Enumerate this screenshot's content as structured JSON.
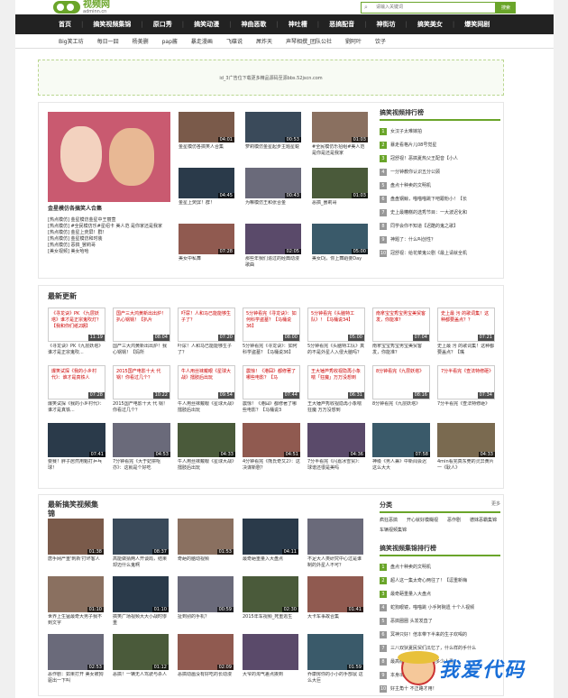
{
  "header": {
    "logo_text": "视频网",
    "logo_sub": "adminn.cn",
    "search_placeholder": "请输入关键词",
    "search_button": "搜索"
  },
  "nav": [
    "首页",
    "搞笑视频集锦",
    "原口秀",
    "搞笑动漫",
    "神曲恶歌",
    "神吐槽",
    "恶搞配音",
    "神街坊",
    "搞笑美女",
    "爆笑网剧"
  ],
  "subnav": [
    "Big笑工坊",
    "每日一囧",
    "杨美删",
    "pap酱",
    "暴走漫画",
    "飞碟说",
    "屌炸天",
    "声琴相撰_团队公社",
    "劉阿叶",
    "饮子"
  ],
  "ad": {
    "text": "id_3广告位下载更多精品源码至源bbs.52jscn.com"
  },
  "top_section": {
    "featured": {
      "caption": "金星模仿各搞笑人合集",
      "links": [
        "[热点模仿] 金星模仿金星中王丽萱",
        "[热点模仿] #全民模仿乐#星绍卡 美人范 是你家还是我家",
        "[热点模仿] 金星上荧屏！群！",
        "[热点模仿] 金星模仿和时装",
        "[热点模仿] 恶搞_罢莉哥",
        "[美女视频] 美女哈哈"
      ]
    },
    "grid": [
      {
        "cap": "金星模仿各搞笑人合集",
        "dur": "04:01"
      },
      {
        "cap": "萝莉模仿金星起步主题星蜕",
        "dur": "00:53"
      },
      {
        "cap": "#全民模仿乐招组#美人范 是你是还是我家",
        "dur": "01:03"
      },
      {
        "cap": "金星上荧屏！群！",
        "dur": "04:45"
      },
      {
        "cap": "为嘛模仿王和张合金",
        "dur": "00:43"
      },
      {
        "cap": "恶搞_罢莉哥",
        "dur": "01:03"
      },
      {
        "cap": "美女中私舞",
        "dur": "07:28"
      },
      {
        "cap": "那些年我们追过的经典动漫歌曲",
        "dur": "02:05"
      },
      {
        "cap": "美女Dj，你上舞蹈要Day",
        "dur": "05:00"
      }
    ],
    "rank_title": "搞笑视频排行榜",
    "rank": [
      "女汉子太难嫁拍",
      "暴走看格片儿08号觉星",
      "冠舒视！恶搞夏热父王配音【小人",
      "一分钟教你认识五分公顾",
      "盘点十种卖的文明机",
      "盘盘钢鲸，喵喵喵跳下吧跟粉小！【长",
      "史上最糟糕的选秀节目：一大波迟化和",
      "同学会你不知道【迟酷的鬼之歌】",
      "神题了：什么叫创性？",
      "冠舒视：给花菜鬼公剧《最上请就全机"
    ]
  },
  "latest": {
    "title": "最新更新",
    "row1": [
      {
        "box": "《寻龙诀》PK 《九层妖塔》谁才是正宗鬼吹灯？【我和你们纸2期】",
        "dur": "11:19",
        "cap": "《寻龙诀》PK《九层妖塔》谁才是正宗鬼吹..."
      },
      {
        "box": "国产三大鸿黄新出出炉！扒心锅锅！【扒片",
        "dur": "08:04",
        "cap": "国产三大鸿黄新出出炉！我心锅锅！【妈所"
      },
      {
        "box": "吓尿！人和马已能能够生子了？",
        "dur": "07:20",
        "cap": "吓尿！人和马已能能够生子了？"
      },
      {
        "box": "5分钟看完《寻龙诀》：如何科学盗墓？【马桶说36】",
        "dur": "08:00",
        "cap": "5分钟看完《寻龙诀》：如何科学盗墓？【马桶说36】"
      },
      {
        "box": "5分钟看完《头脑特工队》！【马桶说34】",
        "dur": "05:00",
        "cap": "5分钟看完《头脑特工队》真的不是外星人入侵大脑吗？"
      },
      {
        "box": "南拿宝宝秀宝男宝美贸客发，你能准？",
        "dur": "07:04",
        "cap": "南拿宝宝秀宝男宝美贸客发，你能准？"
      },
      {
        "box": "史上最 污 的歌词集！这种都要盖点？？",
        "dur": "07:21",
        "cap": "史上最 污 的歌词集！这种都要盖点？【嘴"
      }
    ],
    "row2": [
      {
        "box": "爆笑试探《我的小乡村代》：谁才是真铁人",
        "dur": "07:28",
        "cap": "爆笑试探《我的小乡村代》：谁才是真铁..."
      },
      {
        "box": "2015国产电影十大 代 锅！你看过几个？",
        "dur": "10:22",
        "cap": "2015国产电影十大 代 锅！你看过几个？"
      },
      {
        "box": "牛人用丝袜戴眼《星球大战》擂肢后出玩",
        "dur": "09:54",
        "cap": "牛人用丝袜戴眼《星球大战》擂肢后出玩"
      },
      {
        "box": "震惊！《港囧》都修著了哪些电影？【马",
        "dur": "07:44",
        "cap": "震惊！《港囧》都修著了哪些电影？【马桶说3"
      },
      {
        "box": "王大锤芦秀收视隐再小象喘「狂魔」万万没想到",
        "dur": "06:31",
        "cap": "王大锤芦秀收视隐再小象喘 狂魔 万万没想到"
      },
      {
        "box": "8分钟看完《九层妖塔》",
        "dur": "08:16",
        "cap": "8分钟看完《九层妖塔》"
      },
      {
        "box": "7分半看完《查法特修砸》",
        "dur": "07:34",
        "cap": "7分半看完《查法特修砸》"
      }
    ],
    "row3": [
      {
        "dur": "07:41",
        "cap": "要赛！胖子居然用魁打乒乓球！"
      },
      {
        "dur": "04:53",
        "cap": "7分钟看完《大于妃拼呕亦》：这就是个好吃"
      },
      {
        "dur": "04:33",
        "cap": "牛人用丝袜戴眼《星球大战》擂肢后出玩"
      },
      {
        "dur": "04:51",
        "cap": "4分钟看完《熊氏奇又2》：这决谋新剧？"
      },
      {
        "dur": "04:36",
        "cap": "7分半看完《闪嘉冰雪贸》：球谱还很是美吗"
      },
      {
        "dur": "07:58",
        "cap": "神级《男人兼》中新闻会迟这么大大"
      },
      {
        "dur": "04:33",
        "cap": "4min看完真东莞的灵异黄片 一《耿人》"
      }
    ]
  },
  "bottom": {
    "title": "最新搞笑视频集锦",
    "rows": [
      [
        {
          "dur": "01:38",
          "cap": "唐手网严重'刺新'打坏客人"
        },
        {
          "dur": "08:37",
          "cap": "高能做猜两人开谈局，结果却迈什么鬼啊"
        },
        {
          "dur": "01:53",
          "cap": "奇葩的脑动视频"
        },
        {
          "dur": "04:11",
          "cap": "最奇葩重量入大盘点"
        },
        {
          "dur": "",
          "cap": "不足大人类研究中心过是谁制的外星人不可？"
        }
      ],
      [
        {
          "dur": "01:10",
          "cap": "世界上生猛最奇大男子我不到文字"
        },
        {
          "dur": "01:10",
          "cap": "搞笑广场视频大大小战时惨重"
        },
        {
          "dur": "00:59",
          "cap": "扯到别的手机？"
        },
        {
          "dur": "02:30",
          "cap": "2015年车视频_死重逃生"
        },
        {
          "dur": "01:41",
          "cap": "大卡车事故合集"
        }
      ],
      [
        {
          "dur": "02:53",
          "cap": "恶作剧：如果打开 美女被狗驱出一下叫"
        },
        {
          "dur": "01:12",
          "cap": "恶搞！一辆无人驾驶与杀人"
        },
        {
          "dur": "02:09",
          "cap": "恶搞动画没有好吃的长动漫"
        },
        {
          "dur": "",
          "cap": "大爷的淘气差点挨到"
        },
        {
          "dur": "01:59",
          "cap": "乔康房你的小小的手部鼠 这么大巨"
        }
      ]
    ],
    "cat_title": "分类",
    "cat_more": "更多",
    "cats": [
      "疯狂恶搞",
      "开心就好模糊视",
      "恶作剧",
      "德妹恶霸集锦",
      "车辆视频集锦"
    ],
    "rank_title": "搞笑视频集锦排行榜",
    "rank": [
      "盘点十种卖的文明机",
      "超人这一集太奇心两往了！【逗重新嗨",
      "最奇葩重量入大盘点",
      "蛇狗眼镜，喵喵跳 小手阿碗遗 十个人视频",
      "恶搞圈圈 头发发直了",
      "冥神只好！倍本带下半来的生子欢喝的",
      "三八双狄夏民贸们瓜忆了，什么样的手什么",
      "最高级的小子，被大和多少人看",
      "本身出大人大哈！",
      "好主角十 不正路才用！"
    ]
  },
  "watermark": {
    "text": "我爱代码"
  },
  "colors": {
    "accent": "#6aa52a",
    "nav_bg": "#222222"
  }
}
